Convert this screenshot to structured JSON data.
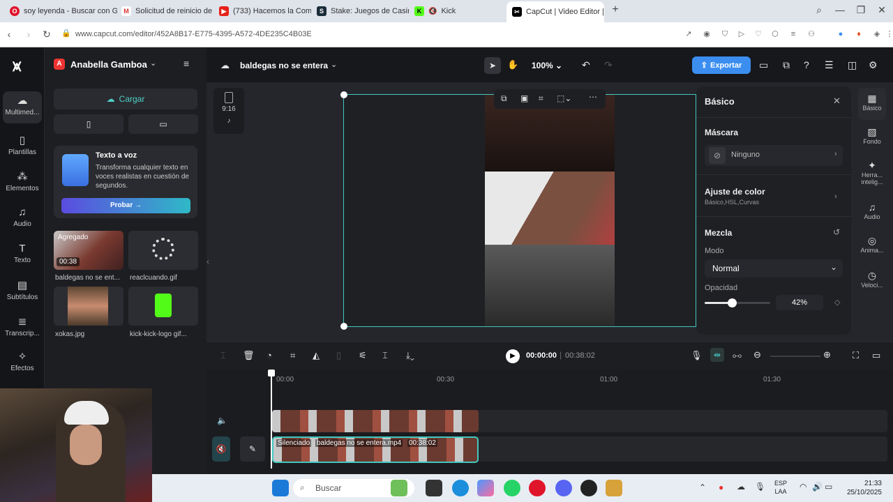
{
  "browser": {
    "tabs": [
      {
        "label": "soy leyenda - Buscar con Google",
        "icon": "opera-icon"
      },
      {
        "label": "Solicitud de reinicio de co",
        "icon": "gmail-icon"
      },
      {
        "label": "(733) Hacemos la Compra",
        "icon": "youtube-icon"
      },
      {
        "label": "Stake: Juegos de Casino O",
        "icon": "stake-icon"
      },
      {
        "label": "Kick",
        "icon": "kick-icon"
      },
      {
        "label": "CapCut | Video Editor | All",
        "icon": "capcut-icon"
      }
    ],
    "new_tab": "+",
    "url": "www.capcut.com/editor/452A8B17-E775-4395-A572-4DE235C4B03E"
  },
  "app": {
    "account_name": "Anabella Gamboa",
    "account_initial": "A",
    "project_name": "baldegas no se entera",
    "zoom": "100%",
    "export_label": "Exportar",
    "aspect_ratio": "9:16",
    "nav": [
      {
        "label": "Multimed...",
        "icon": "cloud-icon"
      },
      {
        "label": "Plantillas",
        "icon": "templates-icon"
      },
      {
        "label": "Elementos",
        "icon": "elements-icon"
      },
      {
        "label": "Audio",
        "icon": "music-icon"
      },
      {
        "label": "Texto",
        "icon": "text-icon"
      },
      {
        "label": "Subtítulos",
        "icon": "subtitles-icon"
      },
      {
        "label": "Transcrip...",
        "icon": "transcript-icon"
      },
      {
        "label": "Efectos",
        "icon": "effects-icon"
      }
    ],
    "panel": {
      "upload_label": "Cargar",
      "promo_title": "Texto a voz",
      "promo_text": "Transforma cualquier texto en voces realistas en cuestión de segundos.",
      "promo_button": "Probar",
      "media": [
        {
          "name": "baldegas no se ent...",
          "badge": "Agregado",
          "duration": "00:38"
        },
        {
          "name": "reaclcuando.gif"
        },
        {
          "name": "xokas.jpg"
        },
        {
          "name": "kick-kick-logo gif..."
        }
      ]
    },
    "right_panel": {
      "title": "Básico",
      "mask_label": "Máscara",
      "mask_value": "Ninguno",
      "color_label": "Ajuste de color",
      "color_sub": "Básico,HSL,Curvas",
      "blend_label": "Mezcla",
      "mode_label": "Modo",
      "mode_value": "Normal",
      "opacity_label": "Opacidad",
      "opacity_value": "42%",
      "opacity_fraction": 0.42
    },
    "right_tabs": [
      {
        "label": "Básico",
        "icon": "basic-icon"
      },
      {
        "label": "Fondo",
        "icon": "background-icon"
      },
      {
        "label": "Herra... intelig...",
        "icon": "smart-tools-icon"
      },
      {
        "label": "Audio",
        "icon": "audio-icon"
      },
      {
        "label": "Anima...",
        "icon": "animation-icon"
      },
      {
        "label": "Veloci...",
        "icon": "speed-icon"
      }
    ],
    "playback": {
      "current": "00:00:00",
      "total": "00:38:02"
    },
    "timeline": {
      "ruler": [
        "00:00",
        "00:30",
        "01:00",
        "01:30"
      ],
      "clip_status": "Silenciado",
      "clip_name": "baldegas no se entera.mp4",
      "clip_duration": "00:38:02"
    }
  },
  "taskbar": {
    "search_placeholder": "Buscar",
    "language": "ESP",
    "language_sub": "LAA",
    "time": "21:33",
    "date": "25/10/2025"
  },
  "colors": {
    "accent": "#3b8ef0",
    "selection": "#42c8c0",
    "promo_gradient_start": "#5b4ce0",
    "promo_gradient_end": "#2fb9c7"
  }
}
